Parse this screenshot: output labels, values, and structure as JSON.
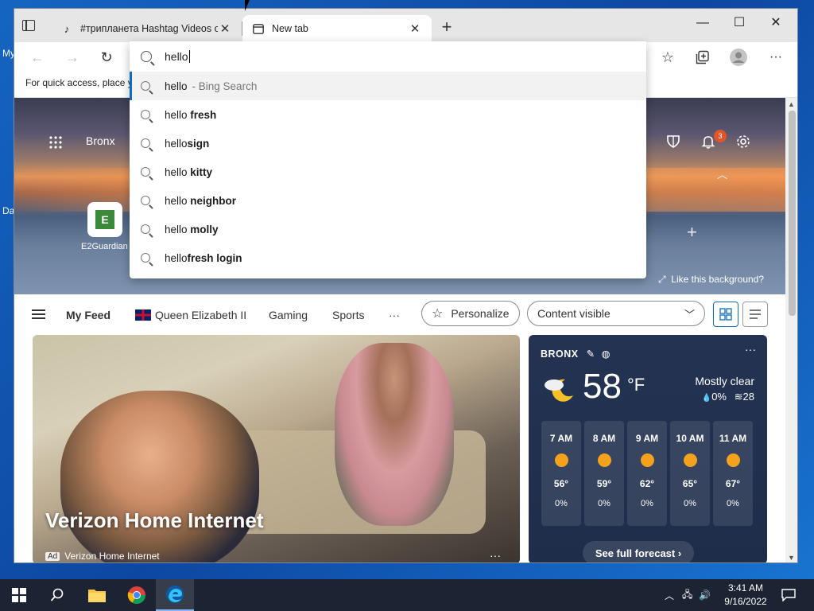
{
  "desktop": {
    "left_texts": [
      "My",
      "Da"
    ]
  },
  "tabs": [
    {
      "label": "#трипланета Hashtag Videos on",
      "favicon": "tiktok-icon"
    },
    {
      "label": "New tab",
      "favicon": "newtab-icon"
    }
  ],
  "window_controls": {
    "minimize": "—",
    "maximize": "☐",
    "close": "✕"
  },
  "favbar": {
    "text": "For quick access, place y"
  },
  "search": {
    "query": "hello",
    "suggestions": [
      {
        "prefix": "hello",
        "bold": "",
        "muted": "- Bing Search"
      },
      {
        "prefix": "hello ",
        "bold": "fresh",
        "muted": ""
      },
      {
        "prefix": "hello",
        "bold": "sign",
        "muted": ""
      },
      {
        "prefix": "hello ",
        "bold": "kitty",
        "muted": ""
      },
      {
        "prefix": "hello ",
        "bold": "neighbor",
        "muted": ""
      },
      {
        "prefix": "hello ",
        "bold": "molly",
        "muted": ""
      },
      {
        "prefix": "hello",
        "bold": "fresh login",
        "muted": ""
      }
    ]
  },
  "hero": {
    "location": "Bronx",
    "tile_letter": "E",
    "tile_label": "E2Guardian",
    "notif_count": "3",
    "like_background": "Like this background?"
  },
  "feed": {
    "my_feed": "My Feed",
    "topic1": "Queen Elizabeth II",
    "topic2": "Gaming",
    "topic3": "Sports",
    "more": "···",
    "personalize": "Personalize",
    "content_visible": "Content visible"
  },
  "card": {
    "title": "Verizon Home Internet",
    "ad_label": "Ad",
    "sponsor": "Verizon Home Internet",
    "more": "···"
  },
  "weather": {
    "location": "BRONX",
    "temp": "58",
    "unit": "°F",
    "condition": "Mostly clear",
    "precip": "0%",
    "wind": "28",
    "hours": [
      {
        "time": "7 AM",
        "temp": "56°",
        "precip": "0%"
      },
      {
        "time": "8 AM",
        "temp": "59°",
        "precip": "0%"
      },
      {
        "time": "9 AM",
        "temp": "62°",
        "precip": "0%"
      },
      {
        "time": "10 AM",
        "temp": "65°",
        "precip": "0%"
      },
      {
        "time": "11 AM",
        "temp": "67°",
        "precip": "0%"
      }
    ],
    "forecast_button": "See full forecast ›"
  },
  "taskbar": {
    "time": "3:41 AM",
    "date": "9/16/2022"
  }
}
